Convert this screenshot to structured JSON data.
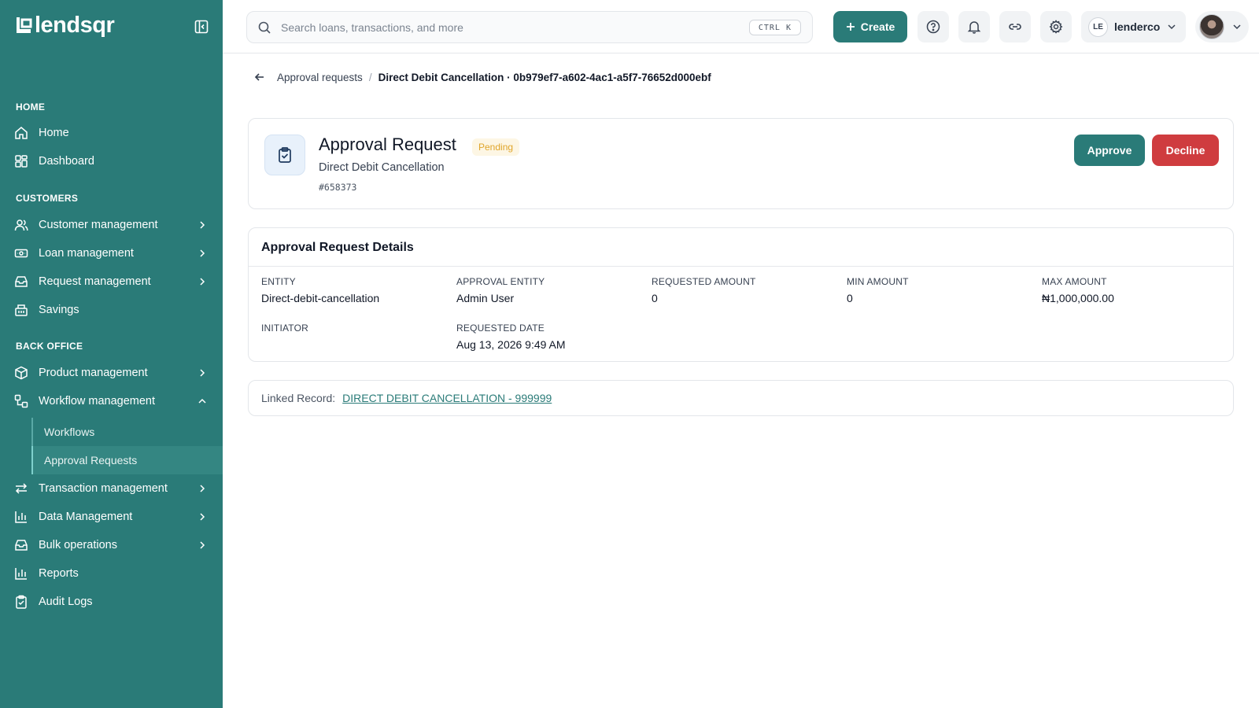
{
  "brand": {
    "name": "lendsqr"
  },
  "sidebar": {
    "sections": [
      {
        "title": "HOME"
      },
      {
        "title": "CUSTOMERS"
      },
      {
        "title": "BACK OFFICE"
      }
    ],
    "items": [
      {
        "label": "Home",
        "icon": "home-icon"
      },
      {
        "label": "Dashboard",
        "icon": "dashboard-icon"
      },
      {
        "label": "Customer management",
        "icon": "users-icon"
      },
      {
        "label": "Loan management",
        "icon": "loan-icon"
      },
      {
        "label": "Request management",
        "icon": "inbox-icon"
      },
      {
        "label": "Savings",
        "icon": "savings-icon"
      },
      {
        "label": "Product management",
        "icon": "package-icon"
      },
      {
        "label": "Workflow management",
        "icon": "workflow-icon"
      },
      {
        "label": "Transaction management",
        "icon": "transfer-icon"
      },
      {
        "label": "Data Management",
        "icon": "bar-chart-icon"
      },
      {
        "label": "Bulk operations",
        "icon": "inbox-icon"
      },
      {
        "label": "Reports",
        "icon": "bar-chart-icon"
      },
      {
        "label": "Audit Logs",
        "icon": "clipboard-icon"
      }
    ],
    "workflow_sub": [
      {
        "label": "Workflows"
      },
      {
        "label": "Approval Requests"
      }
    ]
  },
  "topbar": {
    "search_placeholder": "Search loans, transactions, and more",
    "shortcut": "CTRL K",
    "create_label": "Create",
    "tenant_initials": "LE",
    "tenant_name": "lenderco"
  },
  "breadcrumb": {
    "parent": "Approval requests",
    "separator": "/",
    "current": "Direct Debit Cancellation · 0b979ef7-a602-4ac1-a5f7-76652d000ebf"
  },
  "request": {
    "title": "Approval Request",
    "status": "Pending",
    "type": "Direct Debit Cancellation",
    "id": "#658373",
    "approve_label": "Approve",
    "decline_label": "Decline"
  },
  "details": {
    "title": "Approval Request Details",
    "fields": [
      {
        "label": "ENTITY",
        "value": "Direct-debit-cancellation"
      },
      {
        "label": "APPROVAL ENTITY",
        "value": "Admin User"
      },
      {
        "label": "REQUESTED AMOUNT",
        "value": "0"
      },
      {
        "label": "MIN AMOUNT",
        "value": "0"
      },
      {
        "label": "MAX AMOUNT",
        "value": "₦1,000,000.00"
      },
      {
        "label": "INITIATOR",
        "value": ""
      },
      {
        "label": "REQUESTED DATE",
        "value": "Aug 13, 2026 9:49 AM"
      }
    ]
  },
  "linked": {
    "label": "Linked Record:",
    "value": "DIRECT DEBIT CANCELLATION - 999999"
  },
  "colors": {
    "brand": "#2a7b78",
    "pending": "#e0a52a",
    "decline": "#cf3c3f"
  }
}
